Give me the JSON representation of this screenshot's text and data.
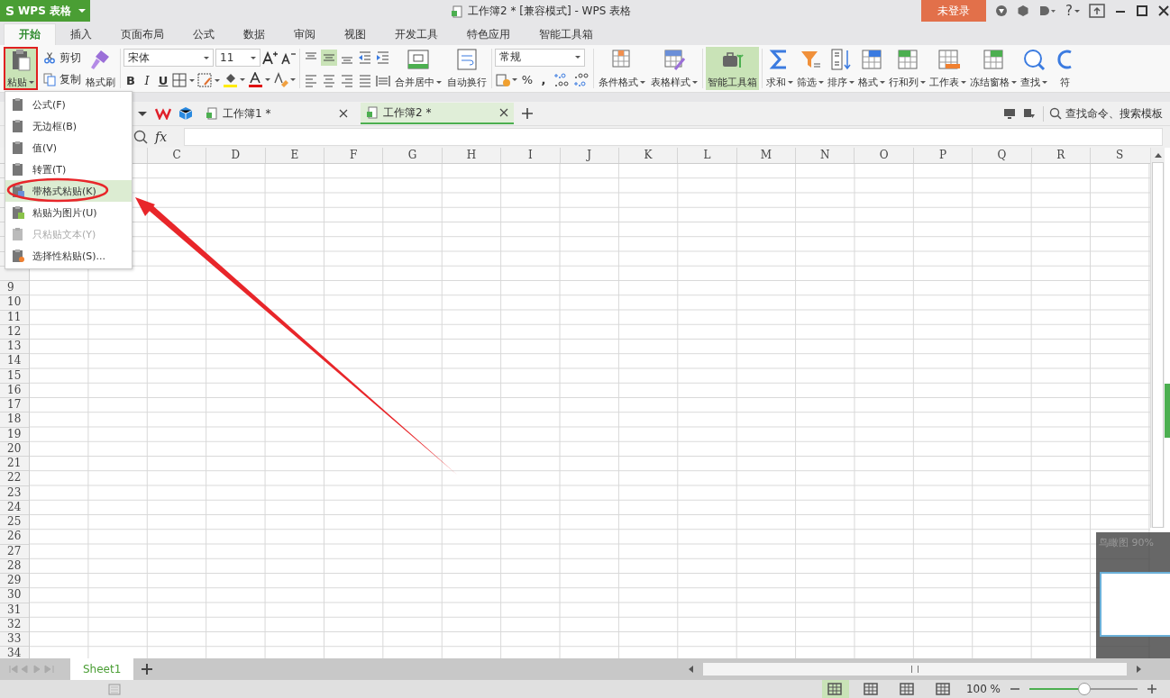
{
  "app_button": {
    "logo": "S",
    "label": "WPS 表格"
  },
  "window": {
    "title": "工作簿2 * [兼容模式] - WPS 表格"
  },
  "login_button": {
    "label": "未登录"
  },
  "help": {
    "label": "?"
  },
  "tabs": [
    {
      "label": "开始",
      "selected": true
    },
    {
      "label": "插入",
      "selected": false
    },
    {
      "label": "页面布局",
      "selected": false
    },
    {
      "label": "公式",
      "selected": false
    },
    {
      "label": "数据",
      "selected": false
    },
    {
      "label": "审阅",
      "selected": false
    },
    {
      "label": "视图",
      "selected": false
    },
    {
      "label": "开发工具",
      "selected": false
    },
    {
      "label": "特色应用",
      "selected": false
    },
    {
      "label": "智能工具箱",
      "selected": false
    }
  ],
  "clipboard": {
    "paste": "粘贴",
    "cut": "剪切",
    "copy": "复制",
    "format_painter": "格式刷"
  },
  "font": {
    "name": "宋体",
    "size": "11",
    "bold": "B",
    "italic": "I",
    "underline": "U"
  },
  "vertical_align": [
    {
      "selected": false
    },
    {
      "selected": true
    },
    {
      "selected": false
    }
  ],
  "alignment": {
    "merge": "合并居中",
    "wrap": "自动换行"
  },
  "number_format": {
    "value": "常规",
    "percent": "%",
    "comma": ","
  },
  "styles": [
    {
      "label": "条件格式"
    },
    {
      "label": "表格样式"
    }
  ],
  "smart_toolbox": {
    "label": "智能工具箱",
    "active": true
  },
  "tools": [
    {
      "label": "求和",
      "dropdown": true
    },
    {
      "label": "筛选",
      "dropdown": true
    },
    {
      "label": "排序",
      "dropdown": true
    },
    {
      "label": "格式",
      "dropdown": true
    },
    {
      "label": "行和列",
      "dropdown": true
    },
    {
      "label": "工作表",
      "dropdown": true
    },
    {
      "label": "冻结窗格",
      "dropdown": true
    },
    {
      "label": "查找",
      "dropdown": true
    },
    {
      "label": "符",
      "dropdown": false
    }
  ],
  "doc_tabs": [
    {
      "label": "工作簿1 *",
      "selected": false
    },
    {
      "label": "工作簿2 *",
      "selected": true
    }
  ],
  "search": {
    "label": "查找命令、搜索模板"
  },
  "formula_bar": {
    "function_label": "fx"
  },
  "columns": [
    "C",
    "D",
    "E",
    "F",
    "G",
    "H",
    "I",
    "J",
    "K",
    "L",
    "M",
    "N",
    "O",
    "P",
    "Q",
    "R",
    "S"
  ],
  "rows": [
    "9",
    "10",
    "11",
    "12",
    "13",
    "14",
    "15",
    "16",
    "17",
    "18",
    "19",
    "20",
    "21",
    "22",
    "23",
    "24",
    "25",
    "26",
    "27",
    "28",
    "29",
    "30",
    "31",
    "32",
    "33",
    "34"
  ],
  "paste_menu": [
    {
      "label": "公式(F)",
      "selected": false,
      "disabled": false
    },
    {
      "label": "无边框(B)",
      "selected": false,
      "disabled": false
    },
    {
      "label": "值(V)",
      "selected": false,
      "disabled": false
    },
    {
      "label": "转置(T)",
      "selected": false,
      "disabled": false
    },
    {
      "label": "带格式粘贴(K)",
      "selected": true,
      "disabled": false
    },
    {
      "label": "粘贴为图片(U)",
      "selected": false,
      "disabled": false
    },
    {
      "label": "只粘贴文本(Y)",
      "selected": false,
      "disabled": true
    },
    {
      "label": "选择性粘贴(S)...",
      "selected": false,
      "disabled": false
    }
  ],
  "birds_eye": {
    "label": "鸟瞰图 90%"
  },
  "sheets": [
    {
      "label": "Sheet1",
      "selected": true
    }
  ],
  "view_buttons": [
    {
      "selected": true
    },
    {
      "selected": false
    },
    {
      "selected": false
    },
    {
      "selected": false
    }
  ],
  "status_bar": {
    "zoom": "100 %"
  },
  "zoom_slider": {
    "level": 0.51
  }
}
